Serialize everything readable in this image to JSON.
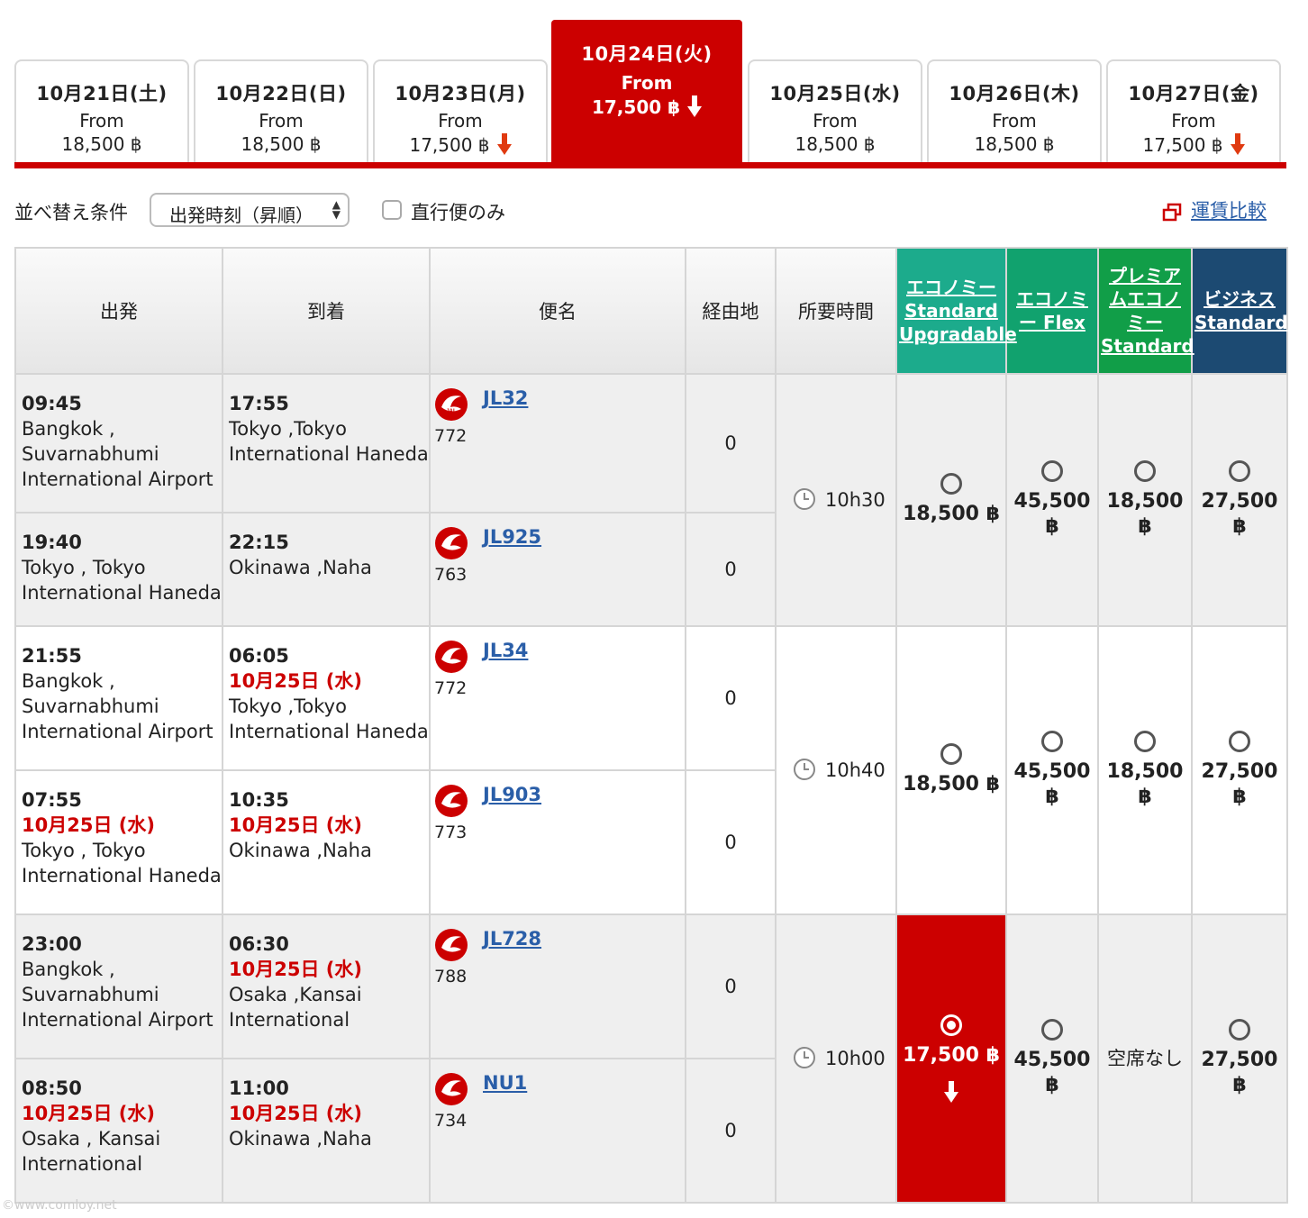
{
  "date_tabs": [
    {
      "date": "10月21日(土)",
      "from_label": "From",
      "price": "18,500 ฿",
      "lower": false,
      "active": false
    },
    {
      "date": "10月22日(日)",
      "from_label": "From",
      "price": "18,500 ฿",
      "lower": false,
      "active": false
    },
    {
      "date": "10月23日(月)",
      "from_label": "From",
      "price": "17,500 ฿",
      "lower": true,
      "active": false
    },
    {
      "date": "10月24日(火)",
      "from_label": "From",
      "price": "17,500 ฿",
      "lower": true,
      "active": true
    },
    {
      "date": "10月25日(水)",
      "from_label": "From",
      "price": "18,500 ฿",
      "lower": false,
      "active": false
    },
    {
      "date": "10月26日(木)",
      "from_label": "From",
      "price": "18,500 ฿",
      "lower": false,
      "active": false
    },
    {
      "date": "10月27日(金)",
      "from_label": "From",
      "price": "17,500 ฿",
      "lower": true,
      "active": false
    }
  ],
  "controls": {
    "sort_label": "並べ替え条件",
    "sort_value": "出発時刻（昇順）",
    "direct_only_label": "直行便のみ",
    "direct_only_checked": false,
    "compare_link": "運賃比較"
  },
  "table_headers": {
    "departure": "出発",
    "arrival": "到着",
    "flight": "便名",
    "stops": "経由地",
    "duration": "所要時間",
    "fares": [
      "エコノミー Standard Upgradable",
      "エコノミー Flex",
      "プレミアムエコノミー Standard",
      "ビジネス Standard"
    ]
  },
  "itineraries": [
    {
      "duration": "10h30",
      "fares": [
        "18,500 ฿",
        "45,500 ฿",
        "18,500 ฿",
        "27,500 ฿"
      ],
      "segments": [
        {
          "dep_time": "09:45",
          "dep_date": "",
          "dep_place": "Bangkok , Suvarnabhumi International Airport",
          "arr_time": "17:55",
          "arr_date": "",
          "arr_place": "Tokyo ,Tokyo International Haneda",
          "flight": "JL32",
          "aircraft": "772",
          "stops": "0"
        },
        {
          "dep_time": "19:40",
          "dep_date": "",
          "dep_place": "Tokyo , Tokyo International Haneda",
          "arr_time": "22:15",
          "arr_date": "",
          "arr_place": "Okinawa ,Naha",
          "flight": "JL925",
          "aircraft": "763",
          "stops": "0"
        }
      ]
    },
    {
      "duration": "10h40",
      "fares": [
        "18,500 ฿",
        "45,500 ฿",
        "18,500 ฿",
        "27,500 ฿"
      ],
      "segments": [
        {
          "dep_time": "21:55",
          "dep_date": "",
          "dep_place": "Bangkok , Suvarnabhumi International Airport",
          "arr_time": "06:05",
          "arr_date": "10月25日 (水)",
          "arr_place": "Tokyo ,Tokyo International Haneda",
          "flight": "JL34",
          "aircraft": "772",
          "stops": "0"
        },
        {
          "dep_time": "07:55",
          "dep_date": "10月25日 (水)",
          "dep_place": "Tokyo , Tokyo International Haneda",
          "arr_time": "10:35",
          "arr_date": "10月25日 (水)",
          "arr_place": "Okinawa ,Naha",
          "flight": "JL903",
          "aircraft": "773",
          "stops": "0"
        }
      ]
    },
    {
      "duration": "10h00",
      "fares": [
        "17,500 ฿",
        "45,500 ฿",
        "空席なし",
        "27,500 ฿"
      ],
      "segments": [
        {
          "dep_time": "23:00",
          "dep_date": "",
          "dep_place": "Bangkok , Suvarnabhumi International Airport",
          "arr_time": "06:30",
          "arr_date": "10月25日 (水)",
          "arr_place": "Osaka ,Kansai International",
          "flight": "JL728",
          "aircraft": "788",
          "stops": "0"
        },
        {
          "dep_time": "08:50",
          "dep_date": "10月25日 (水)",
          "dep_place": "Osaka , Kansai International",
          "arr_time": "11:00",
          "arr_date": "10月25日 (水)",
          "arr_place": "Okinawa ,Naha",
          "flight": "NU1",
          "aircraft": "734",
          "stops": "0"
        }
      ]
    }
  ],
  "selected_fare": {
    "itinerary": 3,
    "fare_class": "エコノミー Standard Upgradable"
  },
  "watermark": "©www.comloy.net",
  "colors": {
    "brand_red": "#cc0000",
    "link_blue": "#2a5ea8",
    "economy_std": "#1cab8c",
    "economy_flex": "#11a26e",
    "premium": "#119e48",
    "business": "#1c4a72"
  }
}
